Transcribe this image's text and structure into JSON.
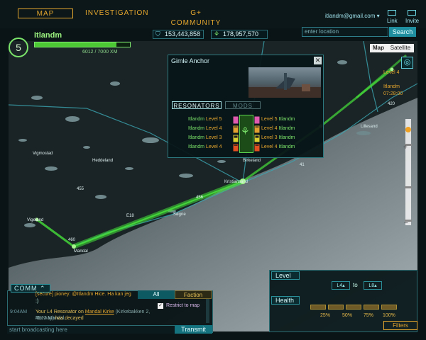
{
  "nav": {
    "tabs": [
      {
        "label": "MAP"
      },
      {
        "label": "INVESTIGATION"
      },
      {
        "label": "G+ COMMUNITY"
      }
    ],
    "user_email": "itlandm@gmail.com",
    "link_label": "Link",
    "invite_label": "Invite"
  },
  "player": {
    "name": "Itlandm",
    "level": "5",
    "xp_text": "6012 / 7000 XM",
    "xp_fraction": 0.86
  },
  "scores": {
    "enlightened": "153,443,858",
    "resistance": "178,957,570"
  },
  "search": {
    "placeholder": "enter location",
    "button": "Search"
  },
  "map_type": {
    "map": "Map",
    "satellite": "Satellite"
  },
  "places": {
    "vigmostad": "Vigmostad",
    "heddeland": "Heddeland",
    "kristiansand": "Kristiansand",
    "sogne": "Søgne",
    "vigeland": "Vigeland",
    "mandal": "Mandal",
    "lillesand": "Lillesand",
    "birkeland": "Birkeland",
    "road_420": "420",
    "road_e18": "E18",
    "road_456": "456",
    "road_460": "460",
    "road_9": "9",
    "road_41": "41",
    "road_455": "455",
    "right_level": "Level 4",
    "right_owner": "Itlandm",
    "right_time": "07:28:00"
  },
  "portal": {
    "title": "Gimle Anchor",
    "tab_resonators": "RESONATORS",
    "tab_mods": "MODS",
    "left": [
      {
        "owner": "Itlandm",
        "level": "Level 5"
      },
      {
        "owner": "Itlandm",
        "level": "Level 4"
      },
      {
        "owner": "Itlandm",
        "level": "Level 3"
      },
      {
        "owner": "Itlandm",
        "level": "Level 4"
      }
    ],
    "right": [
      {
        "owner": "Itlandm",
        "level": "Level 5"
      },
      {
        "owner": "Itlandm",
        "level": "Level 4"
      },
      {
        "owner": "Itlandm",
        "level": "Level 3"
      },
      {
        "owner": "Itlandm",
        "level": "Level 4"
      }
    ],
    "left_fill": [
      1.0,
      0.8,
      0.6,
      0.8
    ],
    "right_fill": [
      1.0,
      0.8,
      0.6,
      0.8
    ],
    "left_colors": [
      "#e05ab0",
      "#e0a030",
      "#d9cf2e",
      "#e05020"
    ],
    "right_colors": [
      "#e05ab0",
      "#e0a030",
      "#d9cf2e",
      "#e05020"
    ]
  },
  "filter": {
    "level_label": "Level",
    "from": "L4",
    "to_word": "to",
    "to": "L8",
    "health_label": "Health",
    "ticks": [
      "25%",
      "50%",
      "75%",
      "100%"
    ],
    "filters_button": "Filters"
  },
  "comm": {
    "tab": "COMM",
    "all": "All",
    "faction": "Faction",
    "restrict": "Restrict to map",
    "restrict_checked": true,
    "line1": "[secure] pioney: @Itlandm Hice. Ha kan jeg",
    "line1b": ":)",
    "time2": "9:04AM",
    "line2_pre": "Your L4 Resonator on ",
    "line2_portal": "Mandal Kirke",
    "line2_addr": " (Kirkebakken 2, 4517 Mandal,",
    "line2_addr2": "Norway)",
    "line2_post": " has decayed",
    "placeholder": "start broadcasting here",
    "transmit": "Transmit"
  }
}
